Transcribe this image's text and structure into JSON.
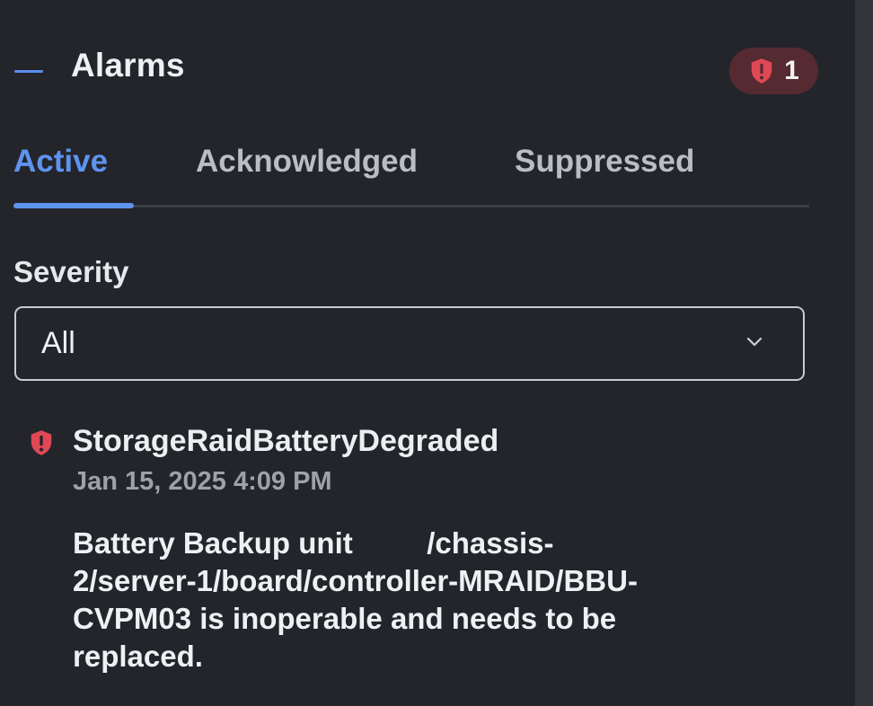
{
  "panel": {
    "title": "Alarms",
    "alarm_count": "1",
    "colors": {
      "background": "#23252b",
      "accent": "#5e93f0",
      "critical": "#e04856",
      "badge_bg": "#552a31"
    }
  },
  "tabs": [
    {
      "label": "Active",
      "active": true
    },
    {
      "label": "Acknowledged",
      "active": false
    },
    {
      "label": "Suppressed",
      "active": false
    }
  ],
  "filter": {
    "label": "Severity",
    "selected": "All",
    "icon": "chevron-down-icon"
  },
  "alarms": [
    {
      "severity_icon": "critical-shield-icon",
      "name": "StorageRaidBatteryDegraded",
      "timestamp": "Jan 15, 2025 4:09 PM",
      "description_lines": [
        "Battery Backup unit         /chassis-",
        "2/server-1/board/controller-MRAID/BBU-",
        "CVPM03 is inoperable and needs to be",
        "replaced."
      ]
    }
  ]
}
